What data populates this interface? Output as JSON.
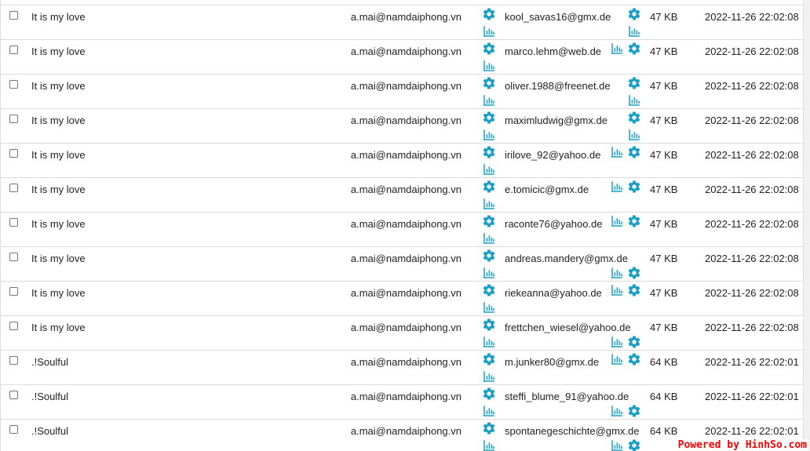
{
  "colors": {
    "accent": "#1aa0c6",
    "divider": "#dcdcdc",
    "watermark": "#ff0000"
  },
  "rows": [
    {
      "subject": "It is my love",
      "sender": "a.mai@namdaiphong.vn",
      "recipient": "kool_savas16@gmx.de",
      "size": "47 KB",
      "date": "2022-11-26 22:02:08"
    },
    {
      "subject": "It is my love",
      "sender": "a.mai@namdaiphong.vn",
      "recipient": "marco.lehm@web.de",
      "size": "47 KB",
      "date": "2022-11-26 22:02:08"
    },
    {
      "subject": "It is my love",
      "sender": "a.mai@namdaiphong.vn",
      "recipient": "oliver.1988@freenet.de",
      "size": "47 KB",
      "date": "2022-11-26 22:02:08"
    },
    {
      "subject": "It is my love",
      "sender": "a.mai@namdaiphong.vn",
      "recipient": "maximludwig@gmx.de",
      "size": "47 KB",
      "date": "2022-11-26 22:02:08"
    },
    {
      "subject": "It is my love",
      "sender": "a.mai@namdaiphong.vn",
      "recipient": "irilove_92@yahoo.de",
      "size": "47 KB",
      "date": "2022-11-26 22:02:08"
    },
    {
      "subject": "It is my love",
      "sender": "a.mai@namdaiphong.vn",
      "recipient": "e.tomicic@gmx.de",
      "size": "47 KB",
      "date": "2022-11-26 22:02:08"
    },
    {
      "subject": "It is my love",
      "sender": "a.mai@namdaiphong.vn",
      "recipient": "raconte76@yahoo.de",
      "size": "47 KB",
      "date": "2022-11-26 22:02:08"
    },
    {
      "subject": "It is my love",
      "sender": "a.mai@namdaiphong.vn",
      "recipient": "andreas.mandery@gmx.de",
      "size": "47 KB",
      "date": "2022-11-26 22:02:08"
    },
    {
      "subject": "It is my love",
      "sender": "a.mai@namdaiphong.vn",
      "recipient": "riekeanna@yahoo.de",
      "size": "47 KB",
      "date": "2022-11-26 22:02:08"
    },
    {
      "subject": "It is my love",
      "sender": "a.mai@namdaiphong.vn",
      "recipient": "frettchen_wiesel@yahoo.de",
      "size": "47 KB",
      "date": "2022-11-26 22:02:08"
    },
    {
      "subject": ".!Soulful",
      "sender": "a.mai@namdaiphong.vn",
      "recipient": "m.junker80@gmx.de",
      "size": "64 KB",
      "date": "2022-11-26 22:02:01"
    },
    {
      "subject": ".!Soulful",
      "sender": "a.mai@namdaiphong.vn",
      "recipient": "steffi_blume_91@yahoo.de",
      "size": "64 KB",
      "date": "2022-11-26 22:02:01"
    },
    {
      "subject": ".!Soulful",
      "sender": "a.mai@namdaiphong.vn",
      "recipient": "spontanegeschichte@gmx.de",
      "size": "64 KB",
      "date": "2022-11-26 22:02:01"
    }
  ],
  "watermark": "Powered by HinhSo.com"
}
